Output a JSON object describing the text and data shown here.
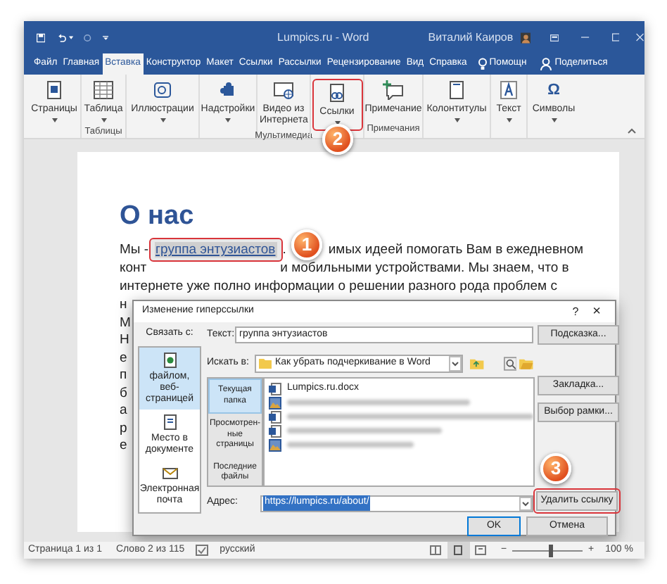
{
  "window": {
    "title": "Lumpics.ru  -  Word",
    "user": "Виталий Каиров"
  },
  "tabs": [
    {
      "label": "Файл",
      "selected": false
    },
    {
      "label": "Главная",
      "selected": false
    },
    {
      "label": "Вставка",
      "selected": true
    },
    {
      "label": "Конструктор",
      "selected": false
    },
    {
      "label": "Макет",
      "selected": false
    },
    {
      "label": "Ссылки",
      "selected": false
    },
    {
      "label": "Рассылки",
      "selected": false
    },
    {
      "label": "Рецензирование",
      "selected": false
    },
    {
      "label": "Вид",
      "selected": false
    },
    {
      "label": "Справка",
      "selected": false
    }
  ],
  "tell_me": "Помощн",
  "share": "Поделиться",
  "ribbon": [
    {
      "buttons": [
        {
          "label": "Страницы",
          "dropdown": true,
          "highlighted": false
        }
      ]
    },
    {
      "label": "Таблицы",
      "buttons": [
        {
          "label": "Таблица",
          "dropdown": true,
          "highlighted": false
        }
      ]
    },
    {
      "buttons": [
        {
          "label": "Иллюстрации",
          "dropdown": true,
          "highlighted": false
        }
      ]
    },
    {
      "buttons": [
        {
          "label": "Надстройки",
          "dropdown": true,
          "highlighted": false
        }
      ]
    },
    {
      "label": "Мультимедиа",
      "buttons": [
        {
          "label": "Видео из Интернета",
          "dropdown": false,
          "highlighted": false
        }
      ]
    },
    {
      "buttons": [
        {
          "label": "Ссылки",
          "dropdown": true,
          "highlighted": true
        }
      ]
    },
    {
      "label": "Примечания",
      "buttons": [
        {
          "label": "Примечание",
          "dropdown": false,
          "highlighted": false
        }
      ]
    },
    {
      "buttons": [
        {
          "label": "Колонтитулы",
          "dropdown": true,
          "highlighted": false
        }
      ]
    },
    {
      "buttons": [
        {
          "label": "Текст",
          "dropdown": true,
          "highlighted": false
        }
      ]
    },
    {
      "buttons": [
        {
          "label": "Символы",
          "dropdown": true,
          "highlighted": false,
          "glyph": "Ω"
        }
      ]
    }
  ],
  "document": {
    "heading": "О нас",
    "lines": [
      [
        {
          "kind": "text",
          "text": "Мы - "
        },
        {
          "kind": "link",
          "text": "группа энтузиастов",
          "highlighted": true
        },
        {
          "kind": "text",
          "text": "."
        },
        {
          "kind": "gap"
        },
        {
          "kind": "text",
          "text": "имых идеей помогать Вам в ежедневном"
        }
      ],
      [
        {
          "kind": "text",
          "text": "конт"
        },
        {
          "kind": "gap"
        },
        {
          "kind": "text",
          "text": "и мобильными устройствами. Мы знаем, что в"
        }
      ],
      [
        {
          "kind": "text",
          "text": "интернете уже полно информации о решении разного рода проблем с"
        }
      ]
    ],
    "fragments": [
      "н",
      "М",
      "Н",
      "е",
      "п",
      "б",
      "а",
      "р",
      "е"
    ]
  },
  "dialog": {
    "title": "Изменение гиперссылки",
    "help": "?",
    "close": "×",
    "link_to_label": "Связать с:",
    "link_to": [
      {
        "label": "файлом, веб-страницей",
        "selected": true
      },
      {
        "label": "Место в документе",
        "selected": false
      },
      {
        "label": "Электронная почта",
        "selected": false
      }
    ],
    "text_label": "Текст:",
    "text_value": "группа энтузиастов",
    "look_in_label": "Искать в:",
    "look_in": "Как убрать подчеркивание в Word",
    "folder_tabs": [
      {
        "label": "Текущая папка",
        "selected": true
      },
      {
        "label": "Просмотрен-ные страницы",
        "selected": false
      },
      {
        "label": "Последние файлы",
        "selected": false
      }
    ],
    "files": [
      {
        "name": "Lumpics.ru.docx",
        "blurred": false
      },
      {
        "blurred": true
      },
      {
        "blurred": true
      },
      {
        "blurred": true
      },
      {
        "blurred": true
      }
    ],
    "address_label": "Адрес:",
    "address": "https://lumpics.ru/about/",
    "address_selected": true,
    "buttons": [
      {
        "label": "Подсказка...",
        "highlighted": false,
        "default": false
      },
      {
        "label": "Закладка...",
        "highlighted": false,
        "default": false
      },
      {
        "label": "Выбор рамки...",
        "highlighted": false,
        "default": false
      },
      {
        "label": "Удалить ссылку",
        "highlighted": true,
        "default": false
      },
      {
        "label": "OK",
        "highlighted": false,
        "default": true
      },
      {
        "label": "Отмена",
        "highlighted": false,
        "default": false
      }
    ]
  },
  "callouts": [
    {
      "number": "1"
    },
    {
      "number": "2"
    },
    {
      "number": "3"
    }
  ],
  "status_bar": {
    "page": "Страница 1 из 1",
    "words": "Слово 2 из 115",
    "language": "русский",
    "views": [
      {
        "selected": false
      },
      {
        "selected": true
      },
      {
        "selected": false
      }
    ],
    "zoom_minus": "−",
    "zoom_plus": "+",
    "zoom": {
      "level": 0.55
    },
    "zoom_label": "100 %"
  }
}
